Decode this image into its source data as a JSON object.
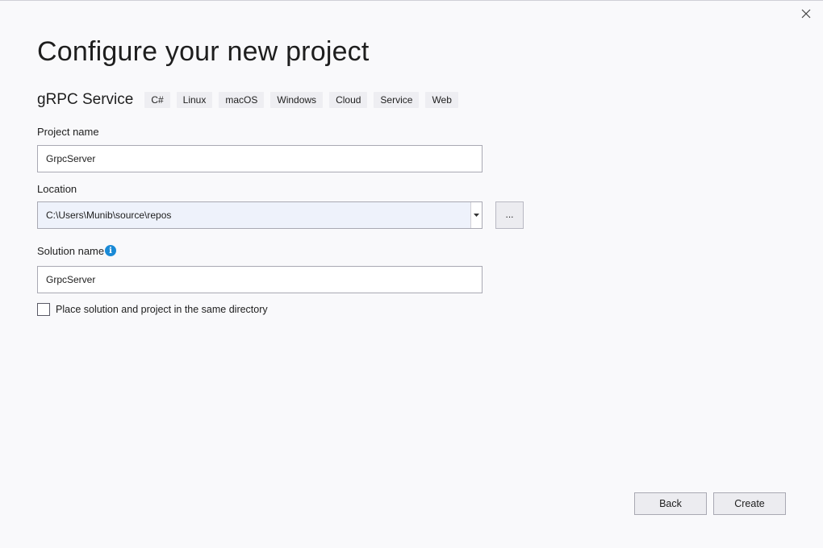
{
  "page_title": "Configure your new project",
  "template": {
    "name": "gRPC Service",
    "tags": [
      "C#",
      "Linux",
      "macOS",
      "Windows",
      "Cloud",
      "Service",
      "Web"
    ]
  },
  "project_name": {
    "label": "Project name",
    "value": "GrpcServer"
  },
  "location": {
    "label": "Location",
    "value": "C:\\Users\\Munib\\source\\repos",
    "browse_label": "..."
  },
  "solution_name": {
    "label": "Solution name",
    "value": "GrpcServer",
    "info_icon": "info-icon"
  },
  "same_directory": {
    "label": "Place solution and project in the same directory",
    "checked": false
  },
  "buttons": {
    "back": "Back",
    "create": "Create"
  },
  "colors": {
    "info_accent": "#1a8ad6",
    "background": "#f9f9fb"
  }
}
